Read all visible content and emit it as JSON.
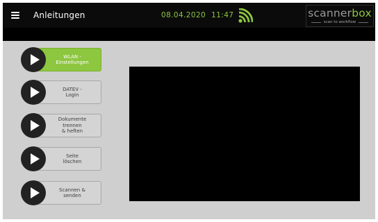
{
  "header": {
    "title": "Anleitungen",
    "date": "08.04.2020",
    "time": "11:47",
    "accent_color": "#8dc63f",
    "icons": {
      "menu": "hamburger-menu-icon",
      "network": "wifi-signal-icon"
    }
  },
  "logo": {
    "brand_part1": "scanner",
    "brand_part2": "box",
    "tagline": "scan to workflow"
  },
  "buttons": [
    {
      "label": "WLAN -\nEinstellungen",
      "active": true
    },
    {
      "label": "DATEV -\nLogin",
      "active": false
    },
    {
      "label": "Dokumente\ntrennen\n& heften",
      "active": false
    },
    {
      "label": "Seite\nlöschen",
      "active": false
    },
    {
      "label": "Scannen &\nsenden",
      "active": false
    }
  ],
  "video": {
    "state": "blank"
  }
}
